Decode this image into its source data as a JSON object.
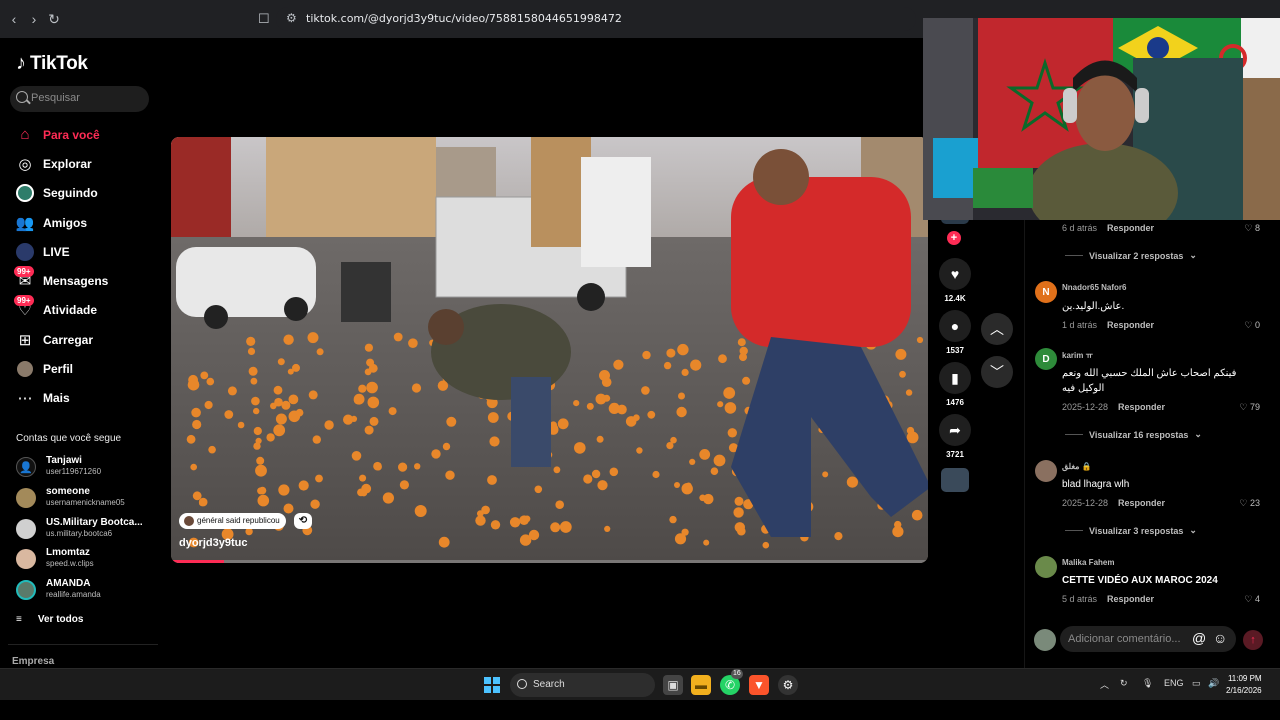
{
  "browser": {
    "url": "tiktok.com/@dyorjd3y9tuc/video/7588158044651998472"
  },
  "sidebar": {
    "logo_text": "TikTok",
    "search_placeholder": "Pesquisar",
    "nav": [
      {
        "label": "Para você",
        "icon": "home-icon",
        "active": true
      },
      {
        "label": "Explorar",
        "icon": "compass-icon"
      },
      {
        "label": "Seguindo",
        "icon": "following-icon"
      },
      {
        "label": "Amigos",
        "icon": "friends-icon"
      },
      {
        "label": "LIVE",
        "icon": "live-icon"
      },
      {
        "label": "Mensagens",
        "icon": "messages-icon",
        "badge": "99+"
      },
      {
        "label": "Atividade",
        "icon": "activity-icon",
        "badge": "99+"
      },
      {
        "label": "Carregar",
        "icon": "upload-icon"
      },
      {
        "label": "Perfil",
        "icon": "profile-icon"
      },
      {
        "label": "Mais",
        "icon": "more-icon"
      }
    ],
    "following_title": "Contas que você segue",
    "accounts": [
      {
        "name": "Tanjawi",
        "user": "user119671260"
      },
      {
        "name": "someone",
        "user": "usernamenickname05"
      },
      {
        "name": "US.Military Bootca...",
        "user": "us.military.bootca6"
      },
      {
        "name": "Lmomtaz",
        "user": "speed.w.clips"
      },
      {
        "name": "AMANDA",
        "user": "reallife.amanda"
      }
    ],
    "see_all": "Ver todos",
    "company": "Empresa"
  },
  "video": {
    "tag": "général said republicou",
    "author": "dyorjd3y9tuc",
    "progress": 0.07
  },
  "actions": {
    "likes": "12.4K",
    "comments": "1537",
    "saves": "1476",
    "shares": "3721"
  },
  "comments": {
    "top_meta": {
      "date": "6 d atrás",
      "reply": "Responder",
      "likes": "8"
    },
    "view_replies_1": "Visualizar 2 respostas",
    "items": [
      {
        "avatar": "N",
        "user": "Nnador65 Nafor6",
        "text": "عاش.الوليد.ين.",
        "date": "1 d atrás",
        "reply": "Responder",
        "likes": "0"
      },
      {
        "avatar": "D",
        "user": "karim ㅠ",
        "text": "فينكم اصحاب عاش الملك حسبي الله ونعم الوكيل فيه",
        "date": "2025-12-28",
        "reply": "Responder",
        "likes": "79"
      },
      {
        "avatar": "",
        "user": "مغلق 🔒",
        "text": "blad lhagra wlh",
        "date": "2025-12-28",
        "reply": "Responder",
        "likes": "23"
      },
      {
        "avatar": "",
        "user": "Malika Fahem",
        "text": "CETTE VIDÉO AUX MAROC 2024",
        "date": "5 d atrás",
        "reply": "Responder",
        "likes": "4"
      }
    ],
    "view_replies_2": "Visualizar 16 respostas",
    "view_replies_3": "Visualizar 3 respostas",
    "input_placeholder": "Adicionar comentário..."
  },
  "taskbar": {
    "search": "Search",
    "whatsapp_badge": "16",
    "lang": "ENG",
    "time": "11:09 PM",
    "date": "2/16/2026"
  }
}
